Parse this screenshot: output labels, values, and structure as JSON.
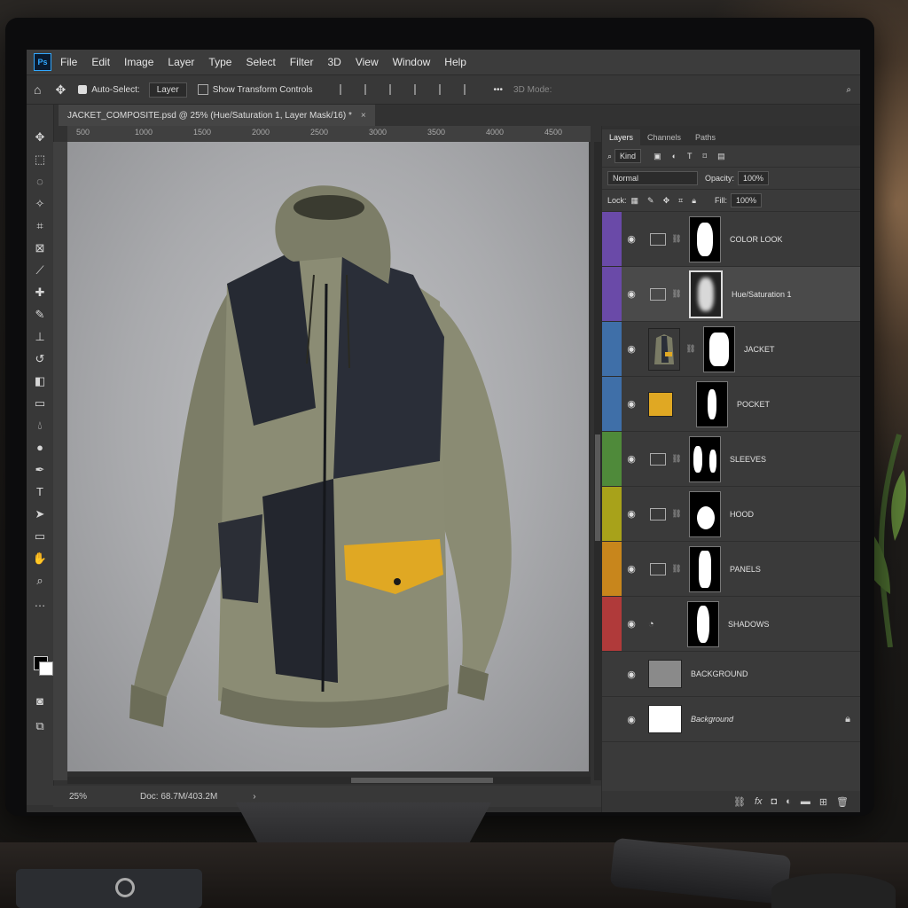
{
  "app": {
    "logo": "Ps"
  },
  "menu": [
    "File",
    "Edit",
    "Image",
    "Layer",
    "Type",
    "Select",
    "Filter",
    "3D",
    "View",
    "Window",
    "Help"
  ],
  "options": {
    "auto_select_label": "Auto-Select:",
    "auto_select_value": "Layer",
    "transform_controls_label": "Show Transform Controls",
    "mode_3d_label": "3D Mode:",
    "more": "•••"
  },
  "document": {
    "tab_title": "JACKET_COMPOSITE.psd @ 25% (Hue/Saturation 1, Layer Mask/16) *",
    "close": "×"
  },
  "ruler": {
    "ticks": [
      "500",
      "1000",
      "1500",
      "2000",
      "2500",
      "3000",
      "3500",
      "4000",
      "4500"
    ]
  },
  "status": {
    "zoom": "25%",
    "doc_info": "Doc: 68.7M/403.2M"
  },
  "panel": {
    "tabs": [
      "Layers",
      "Channels",
      "Paths"
    ],
    "filter_kind": "Kind",
    "blend_mode": "Normal",
    "opacity_label": "Opacity:",
    "opacity_value": "100%",
    "lock_label": "Lock:",
    "fill_label": "Fill:",
    "fill_value": "100%"
  },
  "layers": [
    {
      "name": "COLOR LOOK",
      "color": "#6a4aa8",
      "type": "adjustment"
    },
    {
      "name": "Hue/Saturation 1",
      "color": "#6a4aa8",
      "type": "adjustment",
      "selected": true
    },
    {
      "name": "JACKET",
      "color": "#3f6fa8",
      "type": "image"
    },
    {
      "name": "POCKET",
      "color": "#3f6fa8",
      "type": "solid",
      "thumb_color": "#e0a823"
    },
    {
      "name": "SLEEVES",
      "color": "#4f8a3a",
      "type": "adjustment"
    },
    {
      "name": "HOOD",
      "color": "#a8a21a",
      "type": "adjustment"
    },
    {
      "name": "PANELS",
      "color": "#c8861c",
      "type": "adjustment"
    },
    {
      "name": "SHADOWS",
      "color": "#b03a3a",
      "type": "shadow"
    },
    {
      "name": "BACKGROUND",
      "color": "",
      "type": "gray"
    },
    {
      "name": "Background",
      "color": "",
      "type": "white",
      "locked": true
    }
  ],
  "icons": [
    "home-icon",
    "move-icon",
    "search-icon",
    "eye-icon",
    "chain-icon",
    "lock-icon",
    "fx-icon",
    "trash-icon"
  ]
}
